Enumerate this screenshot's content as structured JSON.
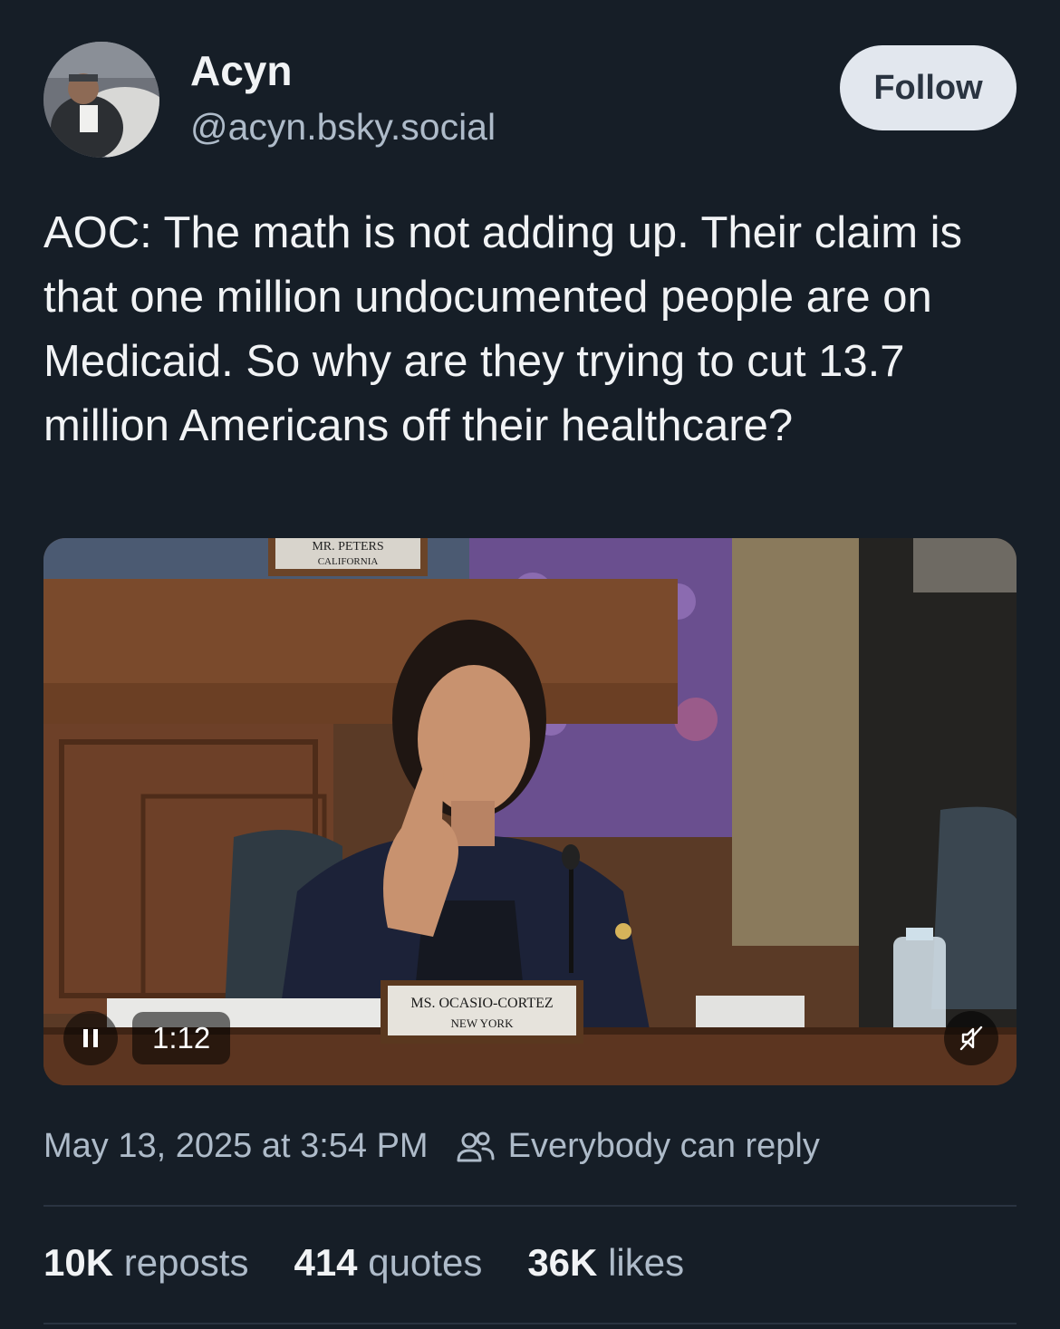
{
  "author": {
    "display_name": "Acyn",
    "handle": "@acyn.bsky.social",
    "follow_label": "Follow"
  },
  "post": {
    "text": "AOC: The math is not adding up. Their claim is that one million undocumented people are on Medicaid. So why are they trying to cut 13.7 million Americans off their healthcare?"
  },
  "video": {
    "time": "1:12",
    "nameplate_top": "MR. PETERS",
    "nameplate_top_sub": "CALIFORNIA",
    "nameplate_main": "MS. OCASIO-CORTEZ",
    "nameplate_main_sub": "NEW YORK",
    "pause_icon": "pause-icon",
    "mute_icon": "muted-speaker-icon"
  },
  "meta": {
    "timestamp": "May 13, 2025 at 3:54 PM",
    "reply_setting": "Everybody can reply"
  },
  "stats": {
    "reposts_count": "10K",
    "reposts_label": "reposts",
    "quotes_count": "414",
    "quotes_label": "quotes",
    "likes_count": "36K",
    "likes_label": "likes"
  },
  "colors": {
    "background": "#161e27",
    "muted_text": "#aebbc9",
    "follow_bg": "#e2e7ee"
  }
}
